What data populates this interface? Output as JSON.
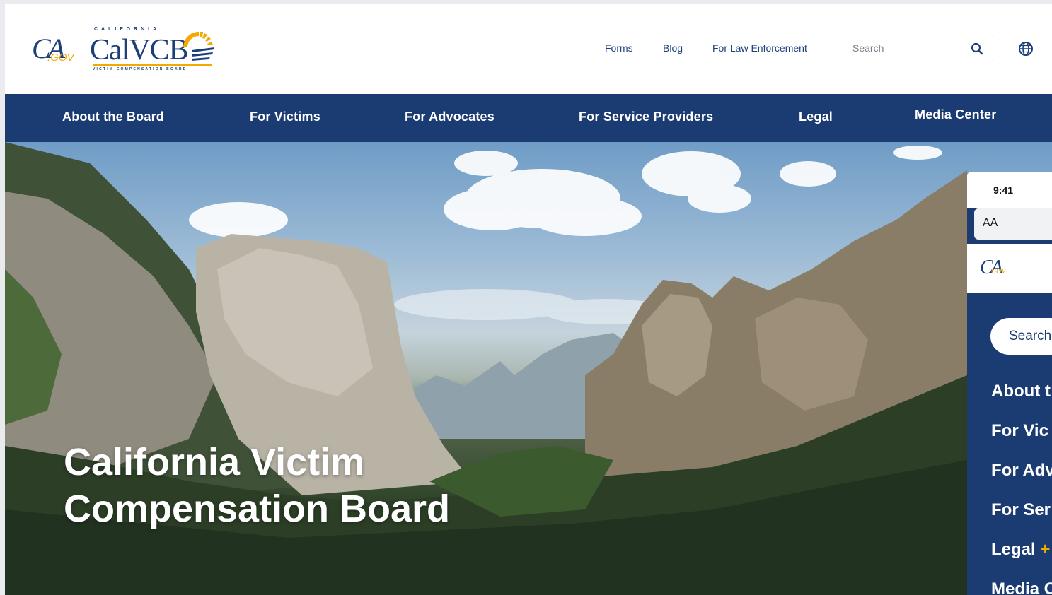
{
  "header": {
    "ca_logo": {
      "ca": "CA",
      "gov": ".GOV"
    },
    "calvcb_logo": {
      "top": "CALIFORNIA",
      "name": "CalVCB",
      "bottom": "VICTIM COMPENSATION BOARD"
    },
    "links": {
      "forms": "Forms",
      "blog": "Blog",
      "law": "For Law Enforcement"
    },
    "search": {
      "placeholder": "Search",
      "icon": "search-icon"
    },
    "globe_icon": "globe-icon"
  },
  "nav": {
    "items": [
      {
        "label": "About the Board"
      },
      {
        "label": "For Victims"
      },
      {
        "label": "For Advocates"
      },
      {
        "label": "For Service Providers"
      },
      {
        "label": "Legal"
      },
      {
        "label": "Media Center"
      }
    ]
  },
  "hero": {
    "title_line1": "California Victim",
    "title_line2": "Compensation Board"
  },
  "phone": {
    "time": "9:41",
    "text_size": "AA",
    "logo": {
      "ca": "CA",
      "gov": "GOV"
    },
    "search": "Search",
    "menu": [
      {
        "label": "About t"
      },
      {
        "label": "For Vic"
      },
      {
        "label": "For Adv"
      },
      {
        "label": "For Ser"
      },
      {
        "label": "Legal",
        "suffix": "+"
      },
      {
        "label": "Media C"
      }
    ]
  },
  "colors": {
    "brand_navy": "#1b3b73",
    "brand_gold": "#f2a900"
  }
}
